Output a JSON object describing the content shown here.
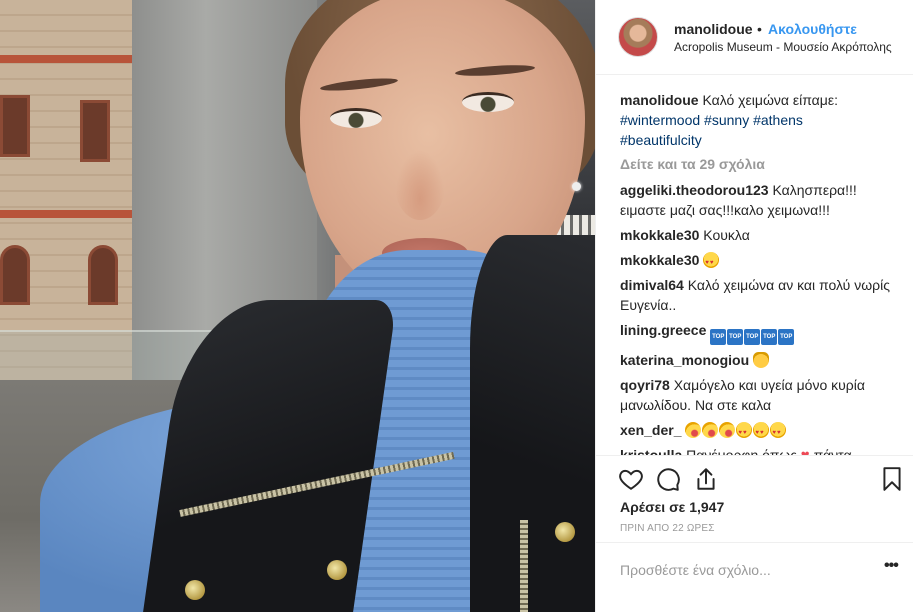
{
  "header": {
    "username": "manolidoue",
    "separator": "•",
    "follow_label": "Ακολουθήστε",
    "location": "Acropolis Museum - Μουσείο Ακρόπολης",
    "avatar_icon": "profile-avatar"
  },
  "caption": {
    "username": "manolidoue",
    "text": " Καλό χειμώνα είπαμε:",
    "hashtags": [
      "#wintermood",
      "#sunny",
      "#athens",
      "#beautifulcity"
    ]
  },
  "view_more": "Δείτε και τα 29 σχόλια",
  "comments": [
    {
      "username": "aggeliki.theodorou123",
      "text": " Καλησπερα!!! ειμαστε μαζι σας!!!καλο χειμωνα!!!"
    },
    {
      "username": "mkokkale30",
      "text": " Κουκλα"
    },
    {
      "username": "mkokkale30",
      "text": "",
      "emoji": [
        "heart-eyes-emoji"
      ]
    },
    {
      "username": "dimival64",
      "text": " Καλό χειμώνα αν και πολύ νωρίς Ευγενία.."
    },
    {
      "username": "lining.greece",
      "text": "",
      "emoji": [
        "top-emoji",
        "top-emoji",
        "top-emoji",
        "top-emoji",
        "top-emoji"
      ]
    },
    {
      "username": "katerina_monogiou",
      "text": "",
      "emoji": [
        "cat-emoji"
      ]
    },
    {
      "username": "qoyri78",
      "text": " Χαμόγελο και υγεία μόνο κυρία μανωλίδου. Να στε καλα"
    },
    {
      "username": "xen_der_",
      "text": "",
      "emoji": [
        "kiss-emoji",
        "kiss-emoji",
        "kiss-emoji",
        "heart-eyes-emoji",
        "heart-eyes-emoji",
        "heart-eyes-emoji"
      ]
    },
    {
      "username": "kristoulla",
      "text_before": " Πανέμορφη όπως ",
      "text_after": " πάντα",
      "emoji": [
        "red-heart-emoji"
      ]
    }
  ],
  "actions": {
    "like_icon": "heart-icon",
    "comment_icon": "comment-icon",
    "share_icon": "share-icon",
    "save_icon": "bookmark-icon",
    "likes_text": "Αρέσει σε 1,947",
    "time_text": "ΠΡΙΝ ΑΠΟ 22 ΩΡΕΣ"
  },
  "add_comment": {
    "placeholder": "Προσθέστε ένα σχόλιο...",
    "options_label": "•••"
  },
  "colors": {
    "link_blue": "#3897f0",
    "hashtag_blue": "#003569",
    "text": "#262626",
    "muted": "#999999",
    "divider": "#efefef"
  }
}
